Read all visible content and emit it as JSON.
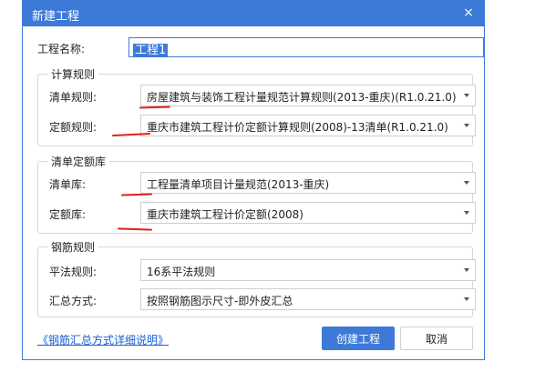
{
  "window": {
    "title": "新建工程",
    "close_glyph": "×"
  },
  "project_name": {
    "label": "工程名称:",
    "value": "工程1"
  },
  "calc_rules": {
    "title": "计算规则",
    "list_rule": {
      "label": "清单规则:",
      "value": "房屋建筑与装饰工程计量规范计算规则(2013-重庆)(R1.0.21.0)"
    },
    "quota_rule": {
      "label": "定额规则:",
      "value": "重庆市建筑工程计价定额计算规则(2008)-13清单(R1.0.21.0)"
    }
  },
  "libraries": {
    "title": "清单定额库",
    "list_lib": {
      "label": "清单库:",
      "value": "工程量清单项目计量规范(2013-重庆)"
    },
    "quota_lib": {
      "label": "定额库:",
      "value": "重庆市建筑工程计价定额(2008)"
    }
  },
  "rebar_rules": {
    "title": "钢筋规则",
    "flat_rule": {
      "label": "平法规则:",
      "value": "16系平法规则"
    },
    "summary_method": {
      "label": "汇总方式:",
      "value": "按照钢筋图示尺寸-即外皮汇总"
    }
  },
  "footer": {
    "link": "《钢筋汇总方式详细说明》",
    "create_button": "创建工程",
    "cancel_button": "取消"
  },
  "colors": {
    "accent": "#3d7ad8",
    "annotation": "#e0201c",
    "link": "#1a5fd6"
  }
}
